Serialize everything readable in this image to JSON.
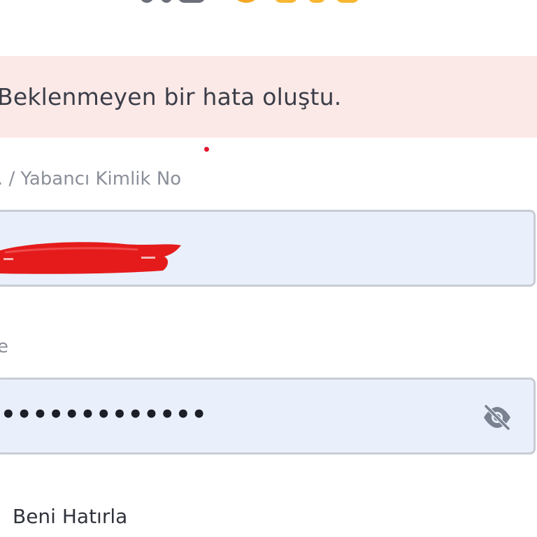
{
  "logo": {
    "brand_colors": {
      "gray": "#6b6f78",
      "orange": "#f5a623",
      "yellow": "#f7b733"
    }
  },
  "alert": {
    "message": "Beklenmeyen bir hata oluştu.",
    "background": "#fbe9e8"
  },
  "id_field": {
    "label": ". / Yabancı Kimlik No",
    "required_marker_color": "#e0152d"
  },
  "password_field": {
    "label": "e",
    "value": "•••••••••••••",
    "toggle_icon": "eye-slash-icon"
  },
  "remember_me": {
    "label": "Beni Hatırla"
  }
}
